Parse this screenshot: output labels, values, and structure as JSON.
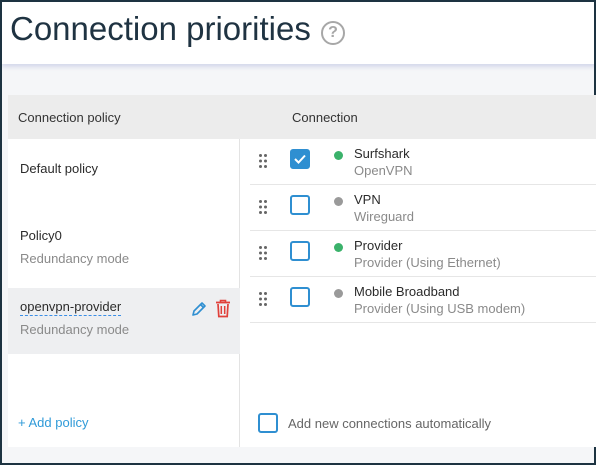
{
  "header": {
    "title": "Connection priorities",
    "help": "?"
  },
  "table": {
    "col_policy": "Connection policy",
    "col_connection": "Connection"
  },
  "policies": [
    {
      "name": "Default policy",
      "sub": ""
    },
    {
      "name": "Policy0",
      "sub": "Redundancy mode"
    },
    {
      "name": "openvpn-provider",
      "sub": "Redundancy mode",
      "selected": true
    }
  ],
  "add_policy_label": "+ Add policy",
  "connections": [
    {
      "name": "Surfshark",
      "sub": "OpenVPN",
      "checked": true,
      "status_color": "#3bb26b"
    },
    {
      "name": "VPN",
      "sub": "Wireguard",
      "checked": false,
      "status_color": "#9a9a9a"
    },
    {
      "name": "Provider",
      "sub": "Provider (Using Ethernet)",
      "checked": false,
      "status_color": "#3bb26b"
    },
    {
      "name": "Mobile Broadband",
      "sub": "Provider (Using USB modem)",
      "checked": false,
      "status_color": "#9a9a9a"
    }
  ],
  "auto_add_label": "Add new connections automatically",
  "colors": {
    "accent": "#2f8fd1",
    "delete": "#e0403a",
    "title": "#1f3342"
  }
}
